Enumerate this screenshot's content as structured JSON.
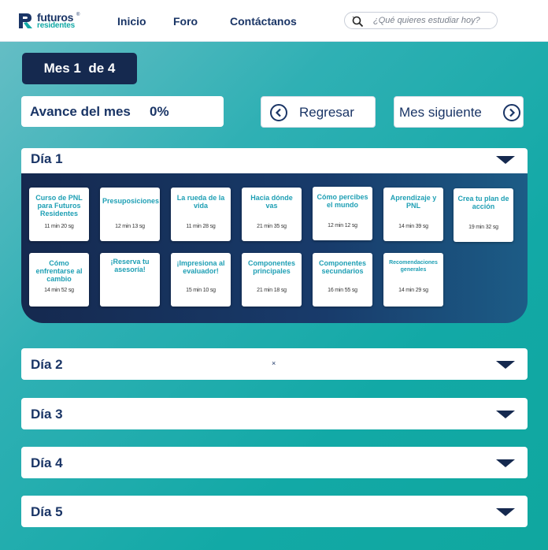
{
  "header": {
    "logo_line1": "futuros",
    "logo_line2": "residentes",
    "logo_reg": "®",
    "nav": [
      "Inicio",
      "Foro",
      "Contáctanos"
    ],
    "search_placeholder": "¿Qué quieres estudiar hoy?"
  },
  "month": {
    "label": "Mes 1  de 4",
    "progress_label": "Avance del mes",
    "progress_value": "0%",
    "back_label": "Regresar",
    "next_label": "Mes siguiente"
  },
  "day1": {
    "title": "Día 1",
    "lessons": [
      {
        "title": "Curso de PNL para Futuros Residentes",
        "duration": "11 min 20 sg"
      },
      {
        "title": "Presuposiciones",
        "duration": "12 min 13 sg"
      },
      {
        "title": "La rueda de la vida",
        "duration": "11 min 28 sg"
      },
      {
        "title": "Hacia dónde vas",
        "duration": "21 min 35 sg"
      },
      {
        "title": "Cómo percibes el mundo",
        "duration": "12 min 12 sg"
      },
      {
        "title": "Aprendizaje y PNL",
        "duration": "14 min 39 sg"
      },
      {
        "title": "Crea tu plan de acción",
        "duration": "19 min 32 sg"
      },
      {
        "title": "Cómo enfrentarse al cambio",
        "duration": "14 min 52 sg"
      },
      {
        "title": "¡Reserva tu asesoría!",
        "duration": ""
      },
      {
        "title": "¡Impresiona al evaluador!",
        "duration": "15 min 10 sg"
      },
      {
        "title": "Componentes principales",
        "duration": "21 min 18 sg"
      },
      {
        "title": "Componentes secundarios",
        "duration": "16 min 55 sg"
      },
      {
        "title": "Recomendaciones generales",
        "duration": "14 min 29 sg"
      }
    ]
  },
  "days": [
    {
      "title": "Día 2",
      "mark": "×"
    },
    {
      "title": "Día 3"
    },
    {
      "title": "Día 4"
    },
    {
      "title": "Día 5"
    }
  ],
  "colors": {
    "navy": "#15294f",
    "text_navy": "#1a3566",
    "teal": "#12a9a6",
    "lesson_title": "#1e9fb4"
  }
}
